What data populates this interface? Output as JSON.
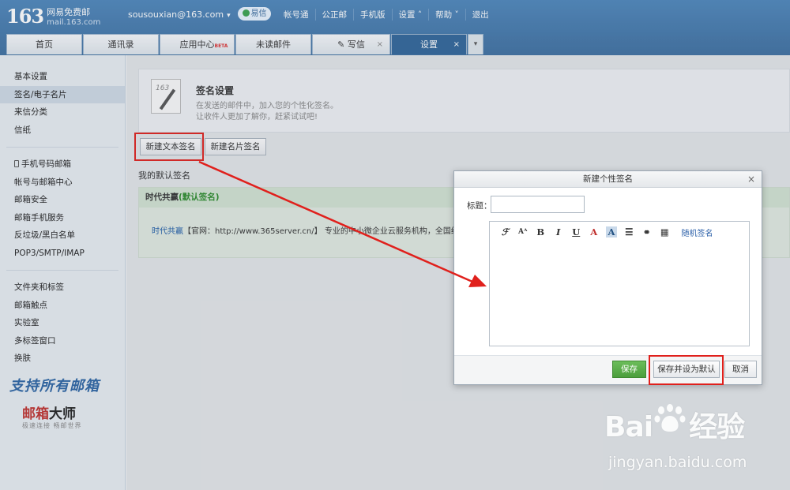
{
  "header": {
    "logo_number": "163",
    "logo_name": "网易免费邮",
    "logo_domain": "mail.163.com",
    "account": "sousouxian@163.com",
    "yixin": "易信",
    "links": [
      "帐号通",
      "公正邮",
      "手机版",
      "设置",
      "帮助",
      "退出"
    ]
  },
  "tabs": [
    {
      "label": "首页"
    },
    {
      "label": "通讯录"
    },
    {
      "label": "应用中心",
      "badge": "BETA"
    },
    {
      "label": "未读邮件"
    },
    {
      "label": "写信"
    },
    {
      "label": "设置"
    }
  ],
  "sidebar": {
    "group1": [
      "基本设置",
      "签名/电子名片",
      "来信分类",
      "信纸"
    ],
    "group2": [
      "手机号码邮箱",
      "帐号与邮箱中心",
      "邮箱安全",
      "邮箱手机服务",
      "反垃圾/黑白名单",
      "POP3/SMTP/IMAP"
    ],
    "group3": [
      "文件夹和标签",
      "邮箱触点",
      "实验室",
      "多标签窗口",
      "换肤"
    ],
    "promo_line1": "支持所有邮箱",
    "promo_brand_a": "邮箱",
    "promo_brand_b": "大师",
    "promo_tagline": "极速连接 畅邮世界"
  },
  "main": {
    "sig_title": "签名设置",
    "sig_desc1": "在发送的邮件中，加入您的个性化签名。",
    "sig_desc2": "让收件人更加了解你，赶紧试试吧!",
    "btn_new_text": "新建文本签名",
    "btn_new_card": "新建名片签名",
    "default_label": "我的默认签名",
    "panel_name": "时代共赢",
    "panel_default": "(默认签名)",
    "panel_body_company": "时代共赢",
    "panel_body_rest": "【官网：http://www.365server.cn/】 专业的中小微企业云服务机构，全国统一免费"
  },
  "dialog": {
    "title": "新建个性签名",
    "title_label": "标题：",
    "title_value": "",
    "toolbar": [
      "字体",
      "字号",
      "B",
      "I",
      "U",
      "A",
      "A",
      "对齐",
      "链接",
      "图片"
    ],
    "random_sig": "随机签名",
    "btn_save": "保存",
    "btn_save_default": "保存并设为默认",
    "btn_cancel": "取消"
  },
  "watermark": {
    "brand": "Bai",
    "brand_tail": "经验",
    "url": "jingyan.baidu.com"
  }
}
